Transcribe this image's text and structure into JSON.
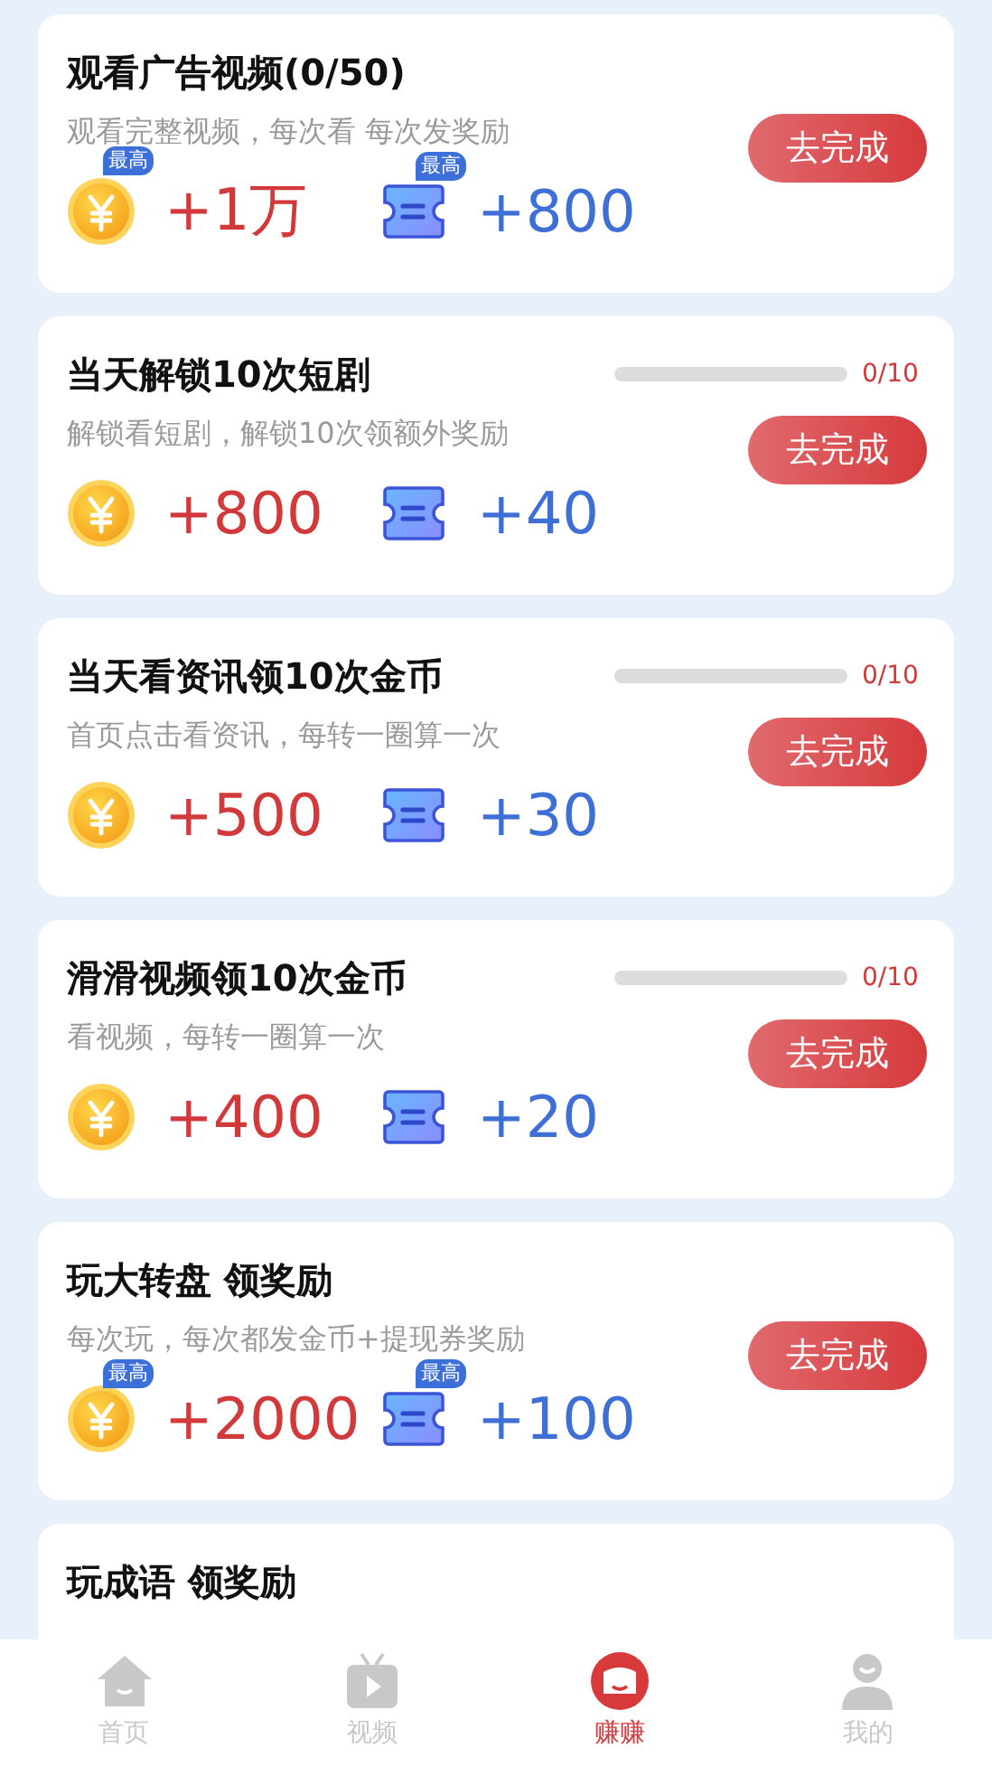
{
  "tasks": [
    {
      "title": "观看广告视频(0/50)",
      "subtitle": "观看完整视频，每次看 每次发奖励",
      "button": "去完成",
      "rewards": [
        {
          "kind": "coin",
          "badge": "最高",
          "amount": "+1万"
        },
        {
          "kind": "ticket",
          "badge": "最高",
          "amount": "+800"
        }
      ]
    },
    {
      "title": "当天解锁10次短剧",
      "subtitle": "解锁看短剧，解锁10次领额外奖励",
      "button": "去完成",
      "progress": {
        "level": 0,
        "reading": "0/10"
      },
      "rewards": [
        {
          "kind": "coin",
          "amount": "+800"
        },
        {
          "kind": "ticket",
          "amount": "+40"
        }
      ]
    },
    {
      "title": "当天看资讯领10次金币",
      "subtitle": "首页点击看资讯，每转一圈算一次",
      "button": "去完成",
      "progress": {
        "level": 0,
        "reading": "0/10"
      },
      "rewards": [
        {
          "kind": "coin",
          "amount": "+500"
        },
        {
          "kind": "ticket",
          "amount": "+30"
        }
      ]
    },
    {
      "title": "滑滑视频领10次金币",
      "subtitle": "看视频，每转一圈算一次",
      "button": "去完成",
      "progress": {
        "level": 0,
        "reading": "0/10"
      },
      "rewards": [
        {
          "kind": "coin",
          "amount": "+400"
        },
        {
          "kind": "ticket",
          "amount": "+20"
        }
      ]
    },
    {
      "title": "玩大转盘 领奖励",
      "subtitle": "每次玩，每次都发金币+提现券奖励",
      "button": "去完成",
      "rewards": [
        {
          "kind": "coin",
          "badge": "最高",
          "amount": "+2000"
        },
        {
          "kind": "ticket",
          "badge": "最高",
          "amount": "+100"
        }
      ]
    },
    {
      "title": "玩成语 领奖励"
    }
  ],
  "tab_bar": [
    {
      "kind": "home",
      "label": "首页",
      "selected": false
    },
    {
      "kind": "video",
      "label": "视频",
      "selected": false
    },
    {
      "kind": "earn",
      "label": "赚赚",
      "selected": true
    },
    {
      "kind": "me",
      "label": "我的",
      "selected": false
    }
  ]
}
